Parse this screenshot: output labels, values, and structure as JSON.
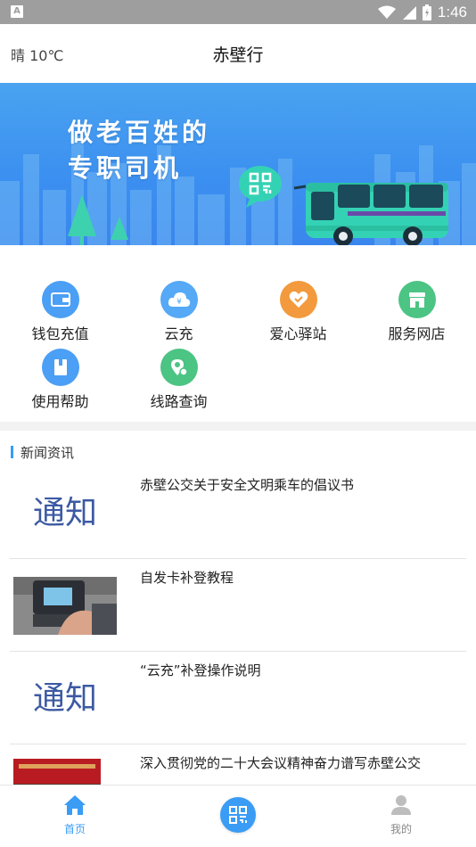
{
  "status_bar": {
    "time": "1:46",
    "app_badge": "A"
  },
  "header": {
    "weather": "晴 10℃",
    "title": "赤壁行"
  },
  "banner": {
    "line1": "做老百姓的",
    "line2": "专职司机"
  },
  "features": [
    {
      "label": "钱包充值",
      "icon": "wallet-icon",
      "color": "#4b9ff4"
    },
    {
      "label": "云充",
      "icon": "cloud-yen-icon",
      "color": "#55a9f6"
    },
    {
      "label": "爱心驿站",
      "icon": "heart-icon",
      "color": "#f29a3d"
    },
    {
      "label": "服务网店",
      "icon": "store-icon",
      "color": "#4cc483"
    },
    {
      "label": "使用帮助",
      "icon": "help-book-icon",
      "color": "#4b9ff4"
    },
    {
      "label": "线路查询",
      "icon": "route-pin-icon",
      "color": "#4cc483"
    }
  ],
  "news": {
    "section_title": "新闻资讯",
    "items": [
      {
        "title": "赤壁公交关于安全文明乘车的倡议书",
        "thumb_text": "通知"
      },
      {
        "title": "自发卡补登教程",
        "thumb_text": ""
      },
      {
        "title": "“云充”补登操作说明",
        "thumb_text": "通知"
      },
      {
        "title": "深入贯彻党的二十大会议精神奋力谱写赤壁公交",
        "thumb_text": ""
      }
    ]
  },
  "bottom_nav": {
    "home_label": "首页",
    "mine_label": "我的"
  },
  "colors": {
    "accent": "#3a9cf5",
    "status_bar": "#9e9e9e"
  }
}
